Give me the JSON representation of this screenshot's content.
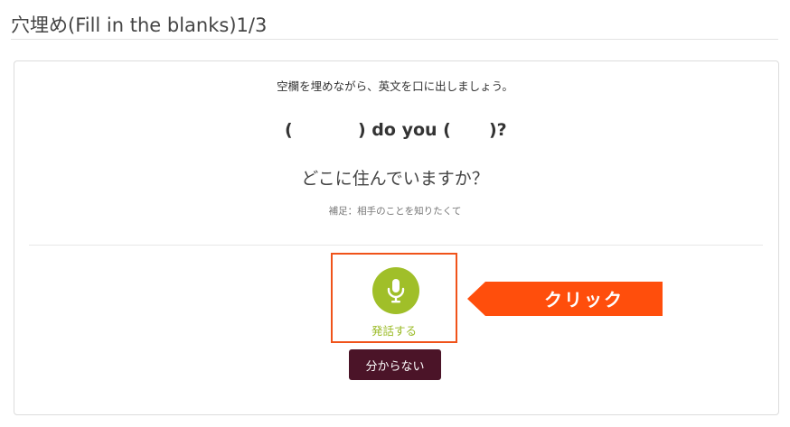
{
  "header": {
    "title": "穴埋め(Fill in the blanks)1/3"
  },
  "exercise": {
    "instruction": "空欄を埋めながら、英文を口に出しましょう。",
    "sentence_parts": [
      "(",
      ") do you (",
      ")?"
    ],
    "translation": "どこに住んでいますか？",
    "hint": "補足：相手のことを知りたくて"
  },
  "actions": {
    "speak_label": "発話する",
    "dont_know_label": "分からない"
  },
  "annotation": {
    "callout_text": "クリック"
  },
  "colors": {
    "mic_green": "#a0bf29",
    "highlight_orange": "#f0531a",
    "callout_orange": "#ff4e0c",
    "button_maroon": "#4b1428"
  }
}
